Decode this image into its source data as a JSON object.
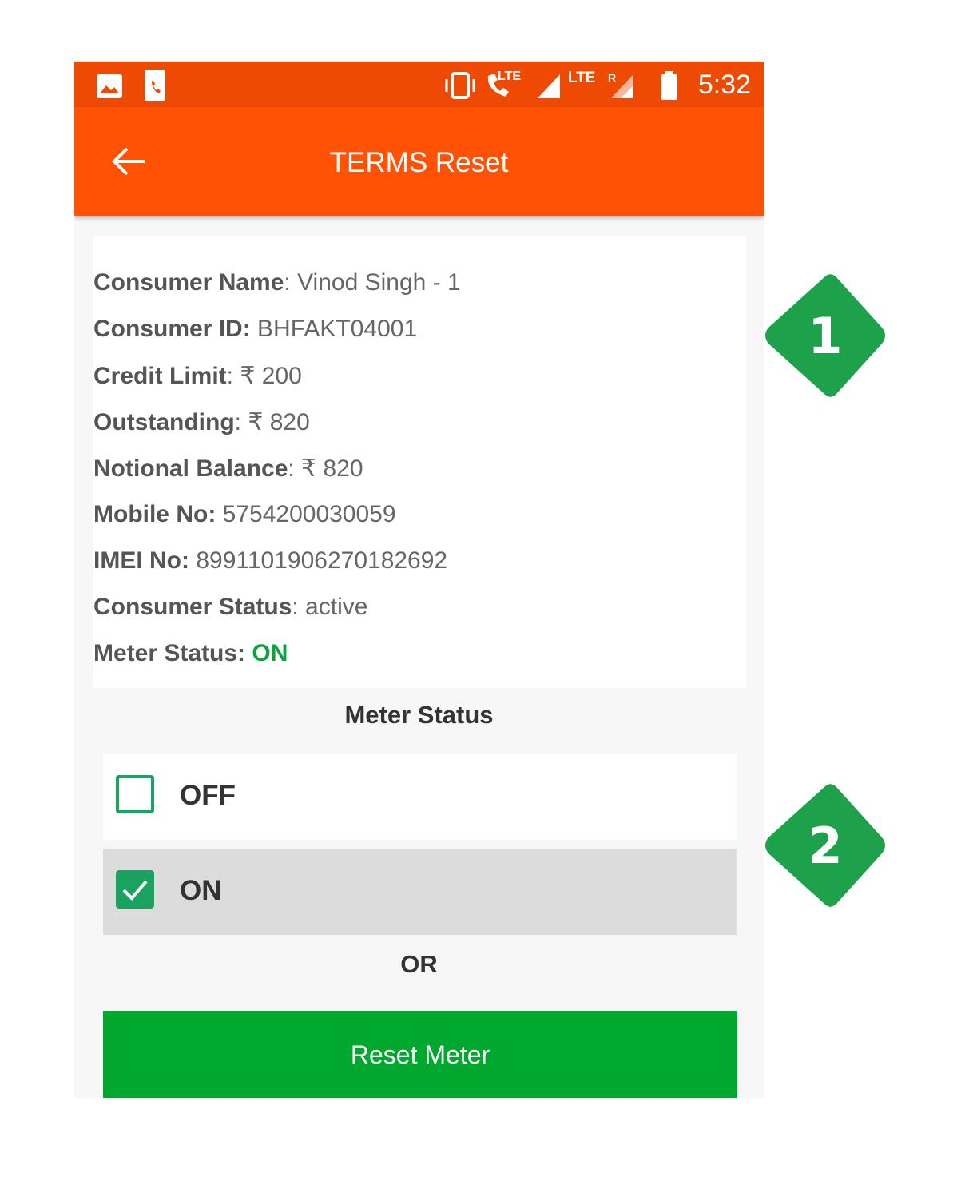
{
  "status_bar": {
    "time": "5:32",
    "lte_1": "LTE",
    "lte_2": "LTE",
    "roaming": "R"
  },
  "app_bar": {
    "title": "TERMS Reset"
  },
  "details": [
    {
      "label": "Consumer Name",
      "value": ": Vinod Singh - 1"
    },
    {
      "label": "Consumer ID:",
      "value": " BHFAKT04001"
    },
    {
      "label": "Credit Limit",
      "value": ": ₹ 200"
    },
    {
      "label": "Outstanding",
      "value": ": ₹ 820"
    },
    {
      "label": "Notional Balance",
      "value": ": ₹ 820"
    },
    {
      "label": "Mobile No:",
      "value": " 5754200030059"
    },
    {
      "label": "IMEI No:",
      "value": " 8991101906270182692"
    },
    {
      "label": "Consumer Status",
      "value": ": active"
    },
    {
      "label": "Meter Status:",
      "value": " ON"
    }
  ],
  "meter_status": {
    "title": "Meter Status",
    "options": [
      {
        "label": "OFF",
        "checked": false
      },
      {
        "label": "ON",
        "checked": true
      }
    ]
  },
  "or_text": "OR",
  "reset_button": {
    "label": "Reset Meter"
  },
  "callouts": [
    "1",
    "2"
  ],
  "colors": {
    "status_bar": "#ee4a04",
    "app_bar": "#ff5205",
    "accent_green": "#1aa260",
    "button_green": "#00a82d"
  }
}
